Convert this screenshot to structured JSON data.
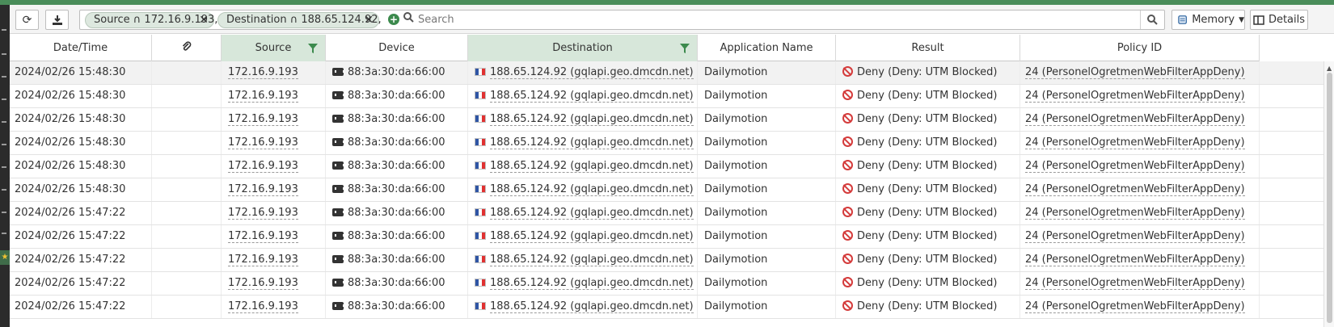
{
  "toolbar": {
    "refresh_icon": "refresh-icon",
    "download_icon": "download-icon",
    "filters": [
      {
        "label": "Source ∩ 172.16.9.193,"
      },
      {
        "label": "Destination ∩ 188.65.124.92,"
      }
    ],
    "search_placeholder": "Search",
    "memory_label": "Memory",
    "details_label": "Details"
  },
  "table": {
    "columns": [
      {
        "label": "Date/Time"
      },
      {
        "label": ""
      },
      {
        "label": "Source"
      },
      {
        "label": "Device"
      },
      {
        "label": "Destination"
      },
      {
        "label": "Application Name"
      },
      {
        "label": "Result"
      },
      {
        "label": "Policy ID"
      }
    ],
    "rows": [
      {
        "datetime": "2024/02/26 15:48:30",
        "source": "172.16.9.193",
        "device": "88:3a:30:da:66:00",
        "destination": "188.65.124.92 (gqlapi.geo.dmcdn.net)",
        "app": "Dailymotion",
        "result": "Deny (Deny: UTM Blocked)",
        "policy": "24 (PersonelOgretmenWebFilterAppDeny)"
      },
      {
        "datetime": "2024/02/26 15:48:30",
        "source": "172.16.9.193",
        "device": "88:3a:30:da:66:00",
        "destination": "188.65.124.92 (gqlapi.geo.dmcdn.net)",
        "app": "Dailymotion",
        "result": "Deny (Deny: UTM Blocked)",
        "policy": "24 (PersonelOgretmenWebFilterAppDeny)"
      },
      {
        "datetime": "2024/02/26 15:48:30",
        "source": "172.16.9.193",
        "device": "88:3a:30:da:66:00",
        "destination": "188.65.124.92 (gqlapi.geo.dmcdn.net)",
        "app": "Dailymotion",
        "result": "Deny (Deny: UTM Blocked)",
        "policy": "24 (PersonelOgretmenWebFilterAppDeny)"
      },
      {
        "datetime": "2024/02/26 15:48:30",
        "source": "172.16.9.193",
        "device": "88:3a:30:da:66:00",
        "destination": "188.65.124.92 (gqlapi.geo.dmcdn.net)",
        "app": "Dailymotion",
        "result": "Deny (Deny: UTM Blocked)",
        "policy": "24 (PersonelOgretmenWebFilterAppDeny)"
      },
      {
        "datetime": "2024/02/26 15:48:30",
        "source": "172.16.9.193",
        "device": "88:3a:30:da:66:00",
        "destination": "188.65.124.92 (gqlapi.geo.dmcdn.net)",
        "app": "Dailymotion",
        "result": "Deny (Deny: UTM Blocked)",
        "policy": "24 (PersonelOgretmenWebFilterAppDeny)"
      },
      {
        "datetime": "2024/02/26 15:48:30",
        "source": "172.16.9.193",
        "device": "88:3a:30:da:66:00",
        "destination": "188.65.124.92 (gqlapi.geo.dmcdn.net)",
        "app": "Dailymotion",
        "result": "Deny (Deny: UTM Blocked)",
        "policy": "24 (PersonelOgretmenWebFilterAppDeny)"
      },
      {
        "datetime": "2024/02/26 15:47:22",
        "source": "172.16.9.193",
        "device": "88:3a:30:da:66:00",
        "destination": "188.65.124.92 (gqlapi.geo.dmcdn.net)",
        "app": "Dailymotion",
        "result": "Deny (Deny: UTM Blocked)",
        "policy": "24 (PersonelOgretmenWebFilterAppDeny)"
      },
      {
        "datetime": "2024/02/26 15:47:22",
        "source": "172.16.9.193",
        "device": "88:3a:30:da:66:00",
        "destination": "188.65.124.92 (gqlapi.geo.dmcdn.net)",
        "app": "Dailymotion",
        "result": "Deny (Deny: UTM Blocked)",
        "policy": "24 (PersonelOgretmenWebFilterAppDeny)"
      },
      {
        "datetime": "2024/02/26 15:47:22",
        "source": "172.16.9.193",
        "device": "88:3a:30:da:66:00",
        "destination": "188.65.124.92 (gqlapi.geo.dmcdn.net)",
        "app": "Dailymotion",
        "result": "Deny (Deny: UTM Blocked)",
        "policy": "24 (PersonelOgretmenWebFilterAppDeny)"
      },
      {
        "datetime": "2024/02/26 15:47:22",
        "source": "172.16.9.193",
        "device": "88:3a:30:da:66:00",
        "destination": "188.65.124.92 (gqlapi.geo.dmcdn.net)",
        "app": "Dailymotion",
        "result": "Deny (Deny: UTM Blocked)",
        "policy": "24 (PersonelOgretmenWebFilterAppDeny)"
      },
      {
        "datetime": "2024/02/26 15:47:22",
        "source": "172.16.9.193",
        "device": "88:3a:30:da:66:00",
        "destination": "188.65.124.92 (gqlapi.geo.dmcdn.net)",
        "app": "Dailymotion",
        "result": "Deny (Deny: UTM Blocked)",
        "policy": "24 (PersonelOgretmenWebFilterAppDeny)"
      }
    ]
  },
  "colors": {
    "accent_green": "#4a8d5a",
    "filtered_header": "#d7e7da",
    "deny_red": "#d43b3b"
  }
}
